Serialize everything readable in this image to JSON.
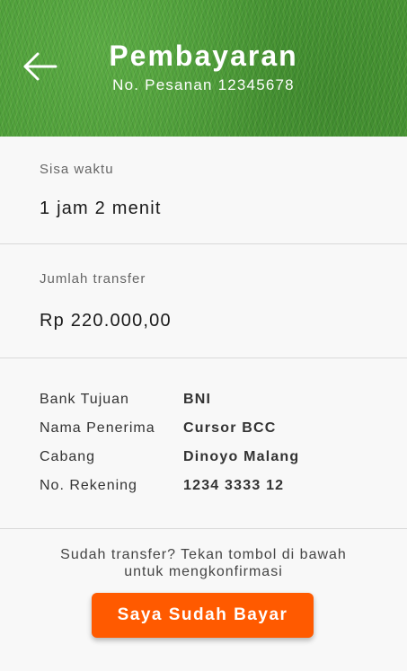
{
  "header": {
    "title": "Pembayaran",
    "order_label": "No. Pesanan 12345678",
    "back_icon": "arrow-left-icon"
  },
  "time_section": {
    "label": "Sisa waktu",
    "value": "1 jam 2 menit"
  },
  "amount_section": {
    "label": "Jumlah transfer",
    "value": "Rp 220.000,00"
  },
  "bank_details": [
    {
      "label": "Bank Tujuan",
      "value": "BNI"
    },
    {
      "label": "Nama Penerima",
      "value": "Cursor BCC"
    },
    {
      "label": "Cabang",
      "value": "Dinoyo Malang"
    },
    {
      "label": "No. Rekening",
      "value": "1234 3333 12"
    }
  ],
  "confirmation": {
    "hint_line1": "Sudah transfer? Tekan tombol di bawah",
    "hint_line2": "untuk mengkonfirmasi",
    "button_label": "Saya Sudah Bayar"
  },
  "colors": {
    "header_green": "#4a9a36",
    "button_orange": "#ff5a00",
    "background": "#f8f8f8"
  }
}
